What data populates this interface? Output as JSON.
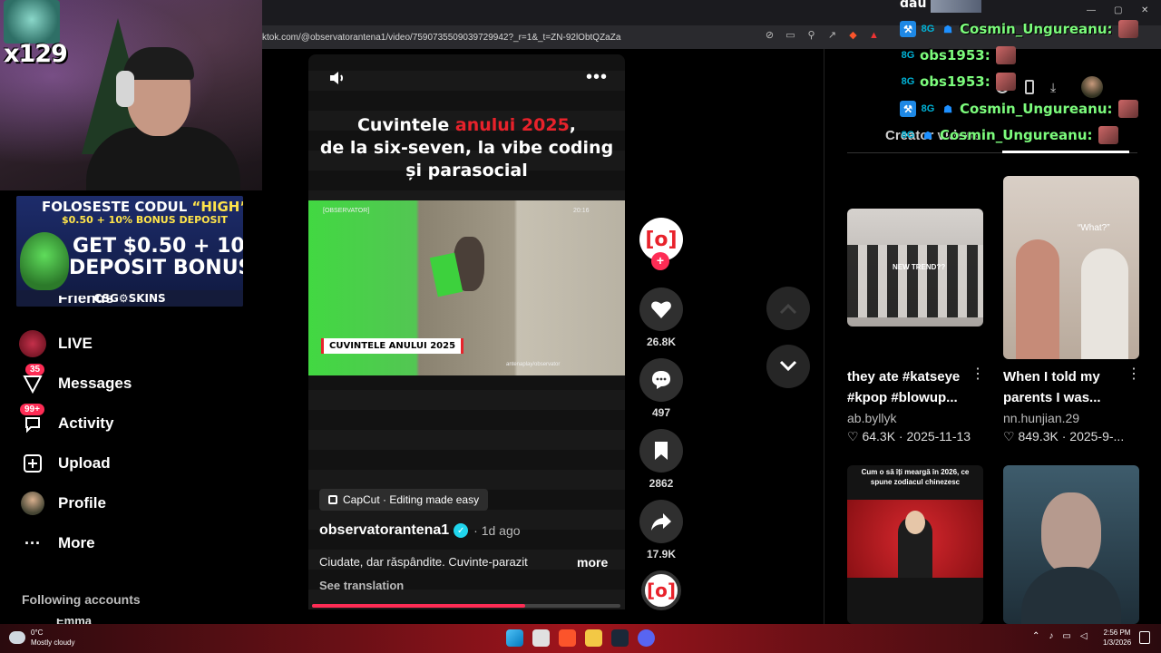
{
  "browser": {
    "url": "ktok.com/@observatorantena1/video/7590735509039729942?_r=1&_t=ZN-92lObtQZaZa"
  },
  "stream": {
    "multiplier": "x129"
  },
  "promo": {
    "line1_prefix": "FOLOSESTE CODUL ",
    "line1_code": "“HIGH”",
    "line2": "$0.50 + 10% BONUS DEPOSIT",
    "line3": "GET $0.50 + 10%",
    "line4": "DEPOSIT BONUS",
    "footer": "CSG⚙SKINS"
  },
  "sidebar": {
    "friends_label": "Friends",
    "items": [
      {
        "label": "LIVE",
        "badge": ""
      },
      {
        "label": "Messages",
        "badge": "35"
      },
      {
        "label": "Activity",
        "badge": "99+"
      },
      {
        "label": "Upload",
        "badge": ""
      },
      {
        "label": "Profile",
        "badge": ""
      },
      {
        "label": "More",
        "badge": ""
      }
    ],
    "following_title": "Following accounts",
    "following_first": "Emma"
  },
  "video": {
    "title_part1": "Cuvintele ",
    "title_red": "anului 2025",
    "title_part2": ",",
    "title_line2": "de la six-seven, la vibe coding",
    "title_line3": "și parasocial",
    "clip_brand": "[OBSERVATOR]",
    "clip_time": "20:16",
    "clip_tag": "CUVINTELE ANULUI 2025",
    "clip_source": "antenaplay/observator",
    "capcut": "CapCut · Editing made easy",
    "author": "observatorantena1",
    "posted": "· 1d ago",
    "description": "Ciudate, dar răspândite. Cuvinte-parazit",
    "more": "more",
    "translation": "See translation",
    "progress": 0.69
  },
  "actions": {
    "likes": "26.8K",
    "comments": "497",
    "saves": "2862",
    "shares": "17.9K",
    "follow": "+"
  },
  "right": {
    "tab_label": "Creator videos",
    "cards": [
      {
        "title": "they ate #katseye #kpop #blowup...",
        "author": "ab.byllyk",
        "likes": "64.3K",
        "date": "2025-11-13",
        "overlay": "NEW TREND??"
      },
      {
        "title": "When I told my parents I was...",
        "author": "nn.hunjian.29",
        "likes": "849.3K",
        "date": "2025-9-...",
        "overlay": "“What?”"
      },
      {
        "title": "",
        "author": "",
        "likes": "",
        "date": "",
        "overlay": "Cum o să îți meargă în 2026, ce spune zodiacul chinezesc"
      },
      {
        "title": "",
        "author": "",
        "likes": "",
        "date": "",
        "overlay": ""
      }
    ]
  },
  "chat": {
    "top_text": "dau",
    "lines": [
      {
        "name": "Cosmin_Ungureanu:",
        "color": "#7CFC7C"
      },
      {
        "name": "obs1953:",
        "color": "#7CFC7C"
      },
      {
        "name": "obs1953:",
        "color": "#7CFC7C"
      },
      {
        "name": "Cosmin_Ungureanu:",
        "color": "#7CFC7C"
      },
      {
        "name": "Cosmin_Ungureanu:",
        "color": "#7CFC7C"
      }
    ]
  },
  "taskbar": {
    "temp": "0°C",
    "weather": "Mostly cloudy",
    "time": "2:56 PM",
    "date": "1/3/2026"
  },
  "colors": {
    "accent": "#fe2c55",
    "obs_red": "#e8222b",
    "chat_green": "#7CFC7C"
  }
}
